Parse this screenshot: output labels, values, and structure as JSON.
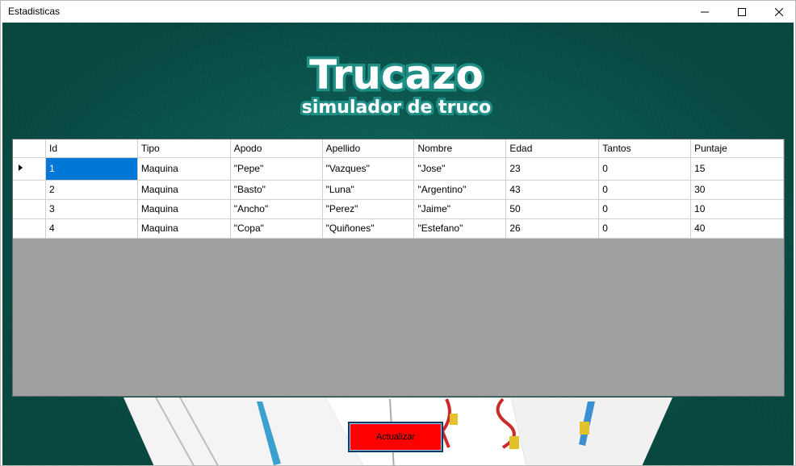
{
  "window": {
    "title": "Estadisticas",
    "controls": {
      "minimize": "minimize-icon",
      "maximize": "maximize-icon",
      "close": "close-icon"
    }
  },
  "logo": {
    "title": "Trucazo",
    "subtitle": "simulador de truco",
    "color": "#ffffff",
    "outline": "#1f8f86"
  },
  "grid": {
    "columns": [
      "Id",
      "Tipo",
      "Apodo",
      "Apellido",
      "Nombre",
      "Edad",
      "Tantos",
      "Puntaje"
    ],
    "rows": [
      [
        "1",
        "Maquina",
        "\"Pepe\"",
        "\"Vazques\"",
        "\"Jose\"",
        "23",
        "0",
        "15"
      ],
      [
        "2",
        "Maquina",
        "\"Basto\"",
        "\"Luna\"",
        "\"Argentino\"",
        "43",
        "0",
        "30"
      ],
      [
        "3",
        "Maquina",
        "\"Ancho\"",
        "\"Perez\"",
        "\"Jaime\"",
        "50",
        "0",
        "10"
      ],
      [
        "4",
        "Maquina",
        "\"Copa\"",
        "\"Quiñones\"",
        "\"Estefano\"",
        "26",
        "0",
        "40"
      ]
    ],
    "current_row_indicator": "row-pointer-icon"
  },
  "actions": {
    "refresh_label": "Actualizar",
    "refresh_color": "#ff0000"
  }
}
